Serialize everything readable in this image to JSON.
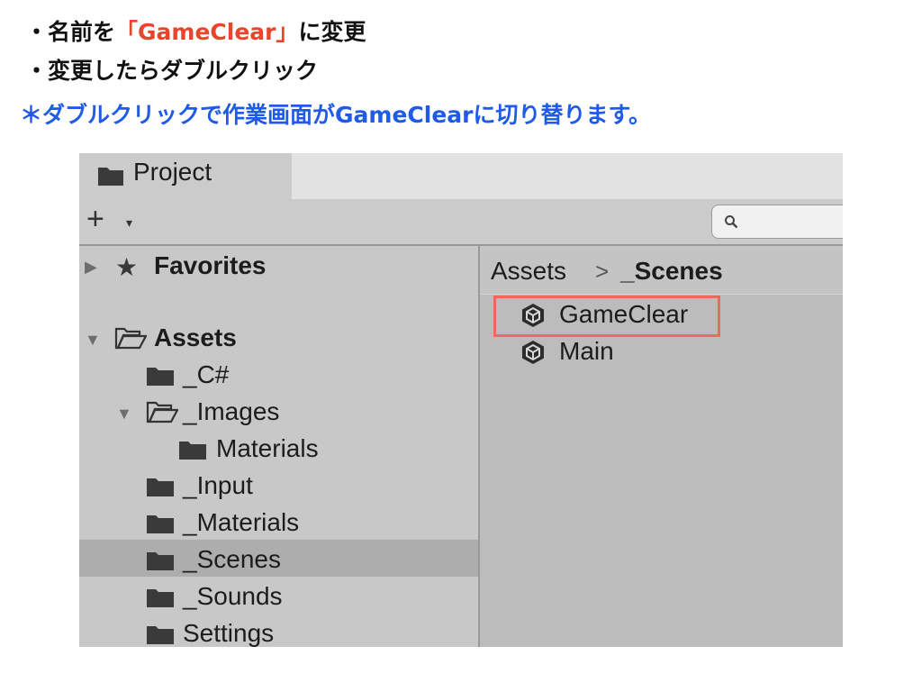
{
  "instructions": {
    "line1_prefix": "・名前を",
    "line1_highlight": "「GameClear」",
    "line1_suffix": "に変更",
    "line2": "・変更したらダブルクリック",
    "line3": "＊ダブルクリックで作業画面がGameClearに切り替ります。"
  },
  "tab": {
    "label": "Project",
    "icon": "folder-icon"
  },
  "toolbar": {
    "add_label": "+",
    "add_caret": "▾"
  },
  "search": {
    "placeholder": ""
  },
  "sidebar": {
    "favorites": {
      "arrow": "▶",
      "star": "★",
      "label": "Favorites"
    },
    "assets": {
      "arrow": "▼",
      "label": "Assets"
    },
    "items": [
      {
        "label": "_C#"
      },
      {
        "arrow": "▼",
        "label": "_Images"
      },
      {
        "label": "Materials"
      },
      {
        "label": "_Input"
      },
      {
        "label": "_Materials"
      },
      {
        "label": "_Scenes"
      },
      {
        "label": "_Sounds"
      },
      {
        "label": "Settings"
      }
    ],
    "selected": "_Scenes"
  },
  "breadcrumb": {
    "root": "Assets",
    "separator": ">",
    "current": "_Scenes"
  },
  "assets_list": [
    {
      "label": "GameClear",
      "icon": "unity-scene-icon",
      "highlighted": true
    },
    {
      "label": "Main",
      "icon": "unity-scene-icon",
      "highlighted": false
    }
  ],
  "colors": {
    "highlight_text": "#e8452c",
    "note_blue": "#1f5ae8",
    "highlight_box": "#ed6a5a"
  }
}
